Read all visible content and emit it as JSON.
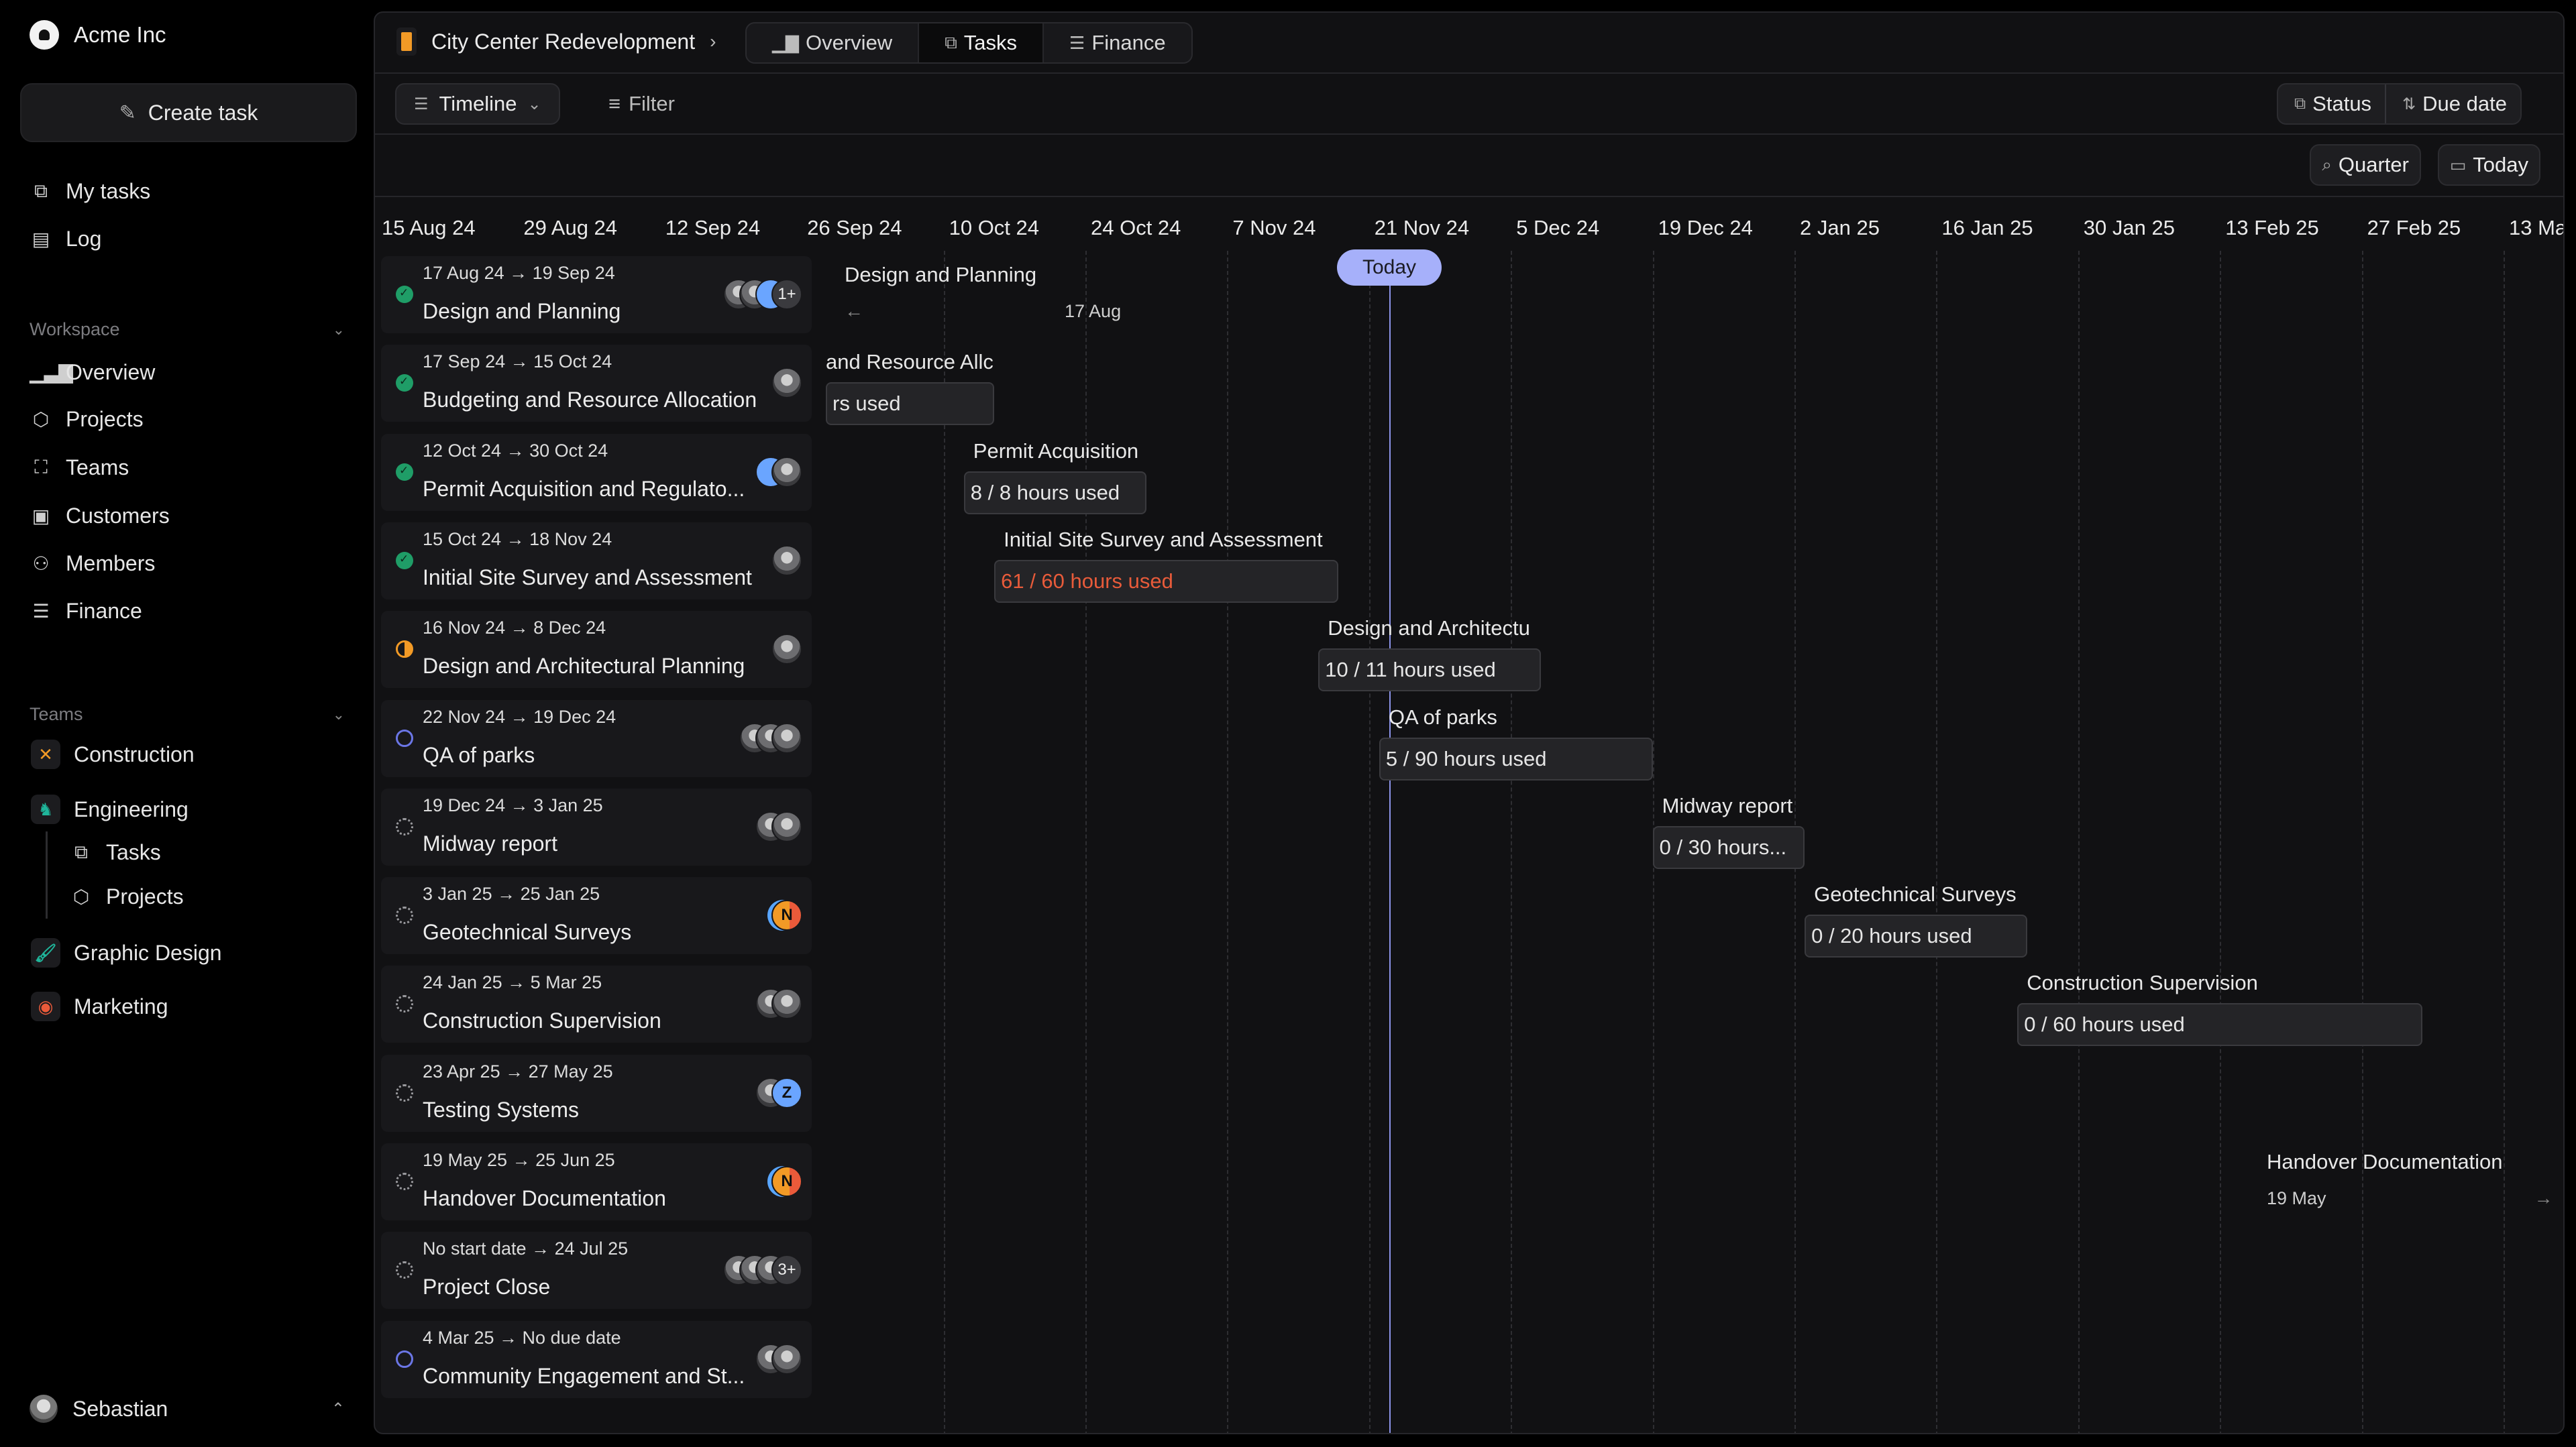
{
  "brand": {
    "name": "Acme Inc"
  },
  "sidebar": {
    "create_task": "Create task",
    "top_items": [
      {
        "label": "My tasks",
        "icon": "layers-icon"
      },
      {
        "label": "Log",
        "icon": "document-icon"
      }
    ],
    "workspace": {
      "heading": "Workspace",
      "items": [
        {
          "label": "Overview",
          "icon": "bar-chart-icon"
        },
        {
          "label": "Projects",
          "icon": "cube-icon"
        },
        {
          "label": "Teams",
          "icon": "scan-icon"
        },
        {
          "label": "Customers",
          "icon": "contact-icon"
        },
        {
          "label": "Members",
          "icon": "users-icon"
        },
        {
          "label": "Finance",
          "icon": "database-icon"
        }
      ]
    },
    "teams": {
      "heading": "Teams",
      "items": [
        {
          "label": "Construction",
          "icon": "tools-icon",
          "color": "#f29a26"
        },
        {
          "label": "Engineering",
          "icon": "elephant-icon",
          "color": "#1fb59a",
          "children": [
            {
              "label": "Tasks",
              "icon": "layers-icon"
            },
            {
              "label": "Projects",
              "icon": "cube-icon"
            }
          ]
        },
        {
          "label": "Graphic Design",
          "icon": "brush-icon",
          "color": "#1fb59a"
        },
        {
          "label": "Marketing",
          "icon": "camera-icon",
          "color": "#ea5a3a"
        }
      ]
    },
    "user": {
      "name": "Sebastian"
    }
  },
  "header": {
    "project": "City Center Redevelopment",
    "tabs": [
      {
        "label": "Overview",
        "icon": "bar-chart-icon",
        "active": false
      },
      {
        "label": "Tasks",
        "icon": "layers-icon",
        "active": true
      },
      {
        "label": "Finance",
        "icon": "database-icon",
        "active": false
      }
    ]
  },
  "toolbar": {
    "view": "Timeline",
    "filter": "Filter",
    "group": "Status",
    "sort": "Due date",
    "zoom": "Quarter",
    "today": "Today"
  },
  "timeline": {
    "origin": "2024-08-15",
    "today": "2024-11-23",
    "today_label": "Today",
    "date_labels": [
      "15 Aug 24",
      "29 Aug 24",
      "12 Sep 24",
      "26 Sep 24",
      "10 Oct 24",
      "24 Oct 24",
      "7 Nov 24",
      "21 Nov 24",
      "5 Dec 24",
      "19 Dec 24",
      "2 Jan 25",
      "16 Jan 25",
      "30 Jan 25",
      "13 Feb 25",
      "27 Feb 25",
      "13 Mar 25"
    ],
    "bars": [
      {
        "label": "Design and Planning",
        "start": "2024-08-17",
        "end": "2024-09-19",
        "offscreen": "left",
        "offscreen_date": "17 Aug"
      },
      {
        "label": "Budgeting and Resource Allocation",
        "start": "2024-09-17",
        "end": "2024-10-15",
        "hours": "hours used",
        "visible_label": "and Resource Allc",
        "visible_hours": "rs used"
      },
      {
        "label": "Permit Acquisition",
        "start": "2024-10-12",
        "end": "2024-10-30",
        "hours": "8 / 8 hours used"
      },
      {
        "label": "Initial Site Survey and Assessment",
        "start": "2024-10-15",
        "end": "2024-11-18",
        "hours": "61 / 60 hours used",
        "over_budget": true
      },
      {
        "label": "Design and Architectu",
        "start": "2024-11-16",
        "end": "2024-12-08",
        "hours": "10 / 11 hours used"
      },
      {
        "label": "QA of parks",
        "start": "2024-11-22",
        "end": "2024-12-19",
        "hours": "5 / 90 hours used"
      },
      {
        "label": "Midway report",
        "start": "2024-12-19",
        "end": "2025-01-03",
        "hours": "0 / 30 hours..."
      },
      {
        "label": "Geotechnical Surveys",
        "start": "2025-01-03",
        "end": "2025-01-25",
        "hours": "0 / 20 hours used"
      },
      {
        "label": "Construction Supervision",
        "start": "2025-01-24",
        "end": "2025-03-05",
        "hours": "0 / 60 hours used"
      },
      null,
      {
        "label": "Handover Documentation",
        "start": "2025-05-19",
        "end": "2025-06-25",
        "offscreen": "right",
        "offscreen_date": "19 May"
      },
      null,
      null
    ]
  },
  "tasks": [
    {
      "dates": "17 Aug 24 → 19 Sep 24",
      "title": "Design and Planning",
      "status": "done",
      "avatars": [
        "photo",
        "photo",
        "blue"
      ],
      "more": "1+"
    },
    {
      "dates": "17 Sep 24 → 15 Oct 24",
      "title": "Budgeting and Resource Allocation",
      "status": "done",
      "avatars": [
        "photo"
      ]
    },
    {
      "dates": "12 Oct 24 → 30 Oct 24",
      "title": "Permit Acquisition and Regulato...",
      "status": "done",
      "avatars": [
        "blue",
        "photo"
      ]
    },
    {
      "dates": "15 Oct 24 → 18 Nov 24",
      "title": "Initial Site Survey and Assessment",
      "status": "done",
      "avatars": [
        "photo"
      ]
    },
    {
      "dates": "16 Nov 24 → 8 Dec 24",
      "title": "Design and Architectural Planning",
      "status": "progress",
      "avatars": [
        "photo"
      ]
    },
    {
      "dates": "22 Nov 24 → 19 Dec 24",
      "title": "QA of parks",
      "status": "todo",
      "avatars": [
        "photo",
        "photo",
        "photo"
      ]
    },
    {
      "dates": "19 Dec 24 → 3 Jan 25",
      "title": "Midway report",
      "status": "backlog",
      "avatars": [
        "photo",
        "photo"
      ]
    },
    {
      "dates": "3 Jan 25 → 25 Jan 25",
      "title": "Geotechnical Surveys",
      "status": "backlog",
      "avatars": [
        "N"
      ]
    },
    {
      "dates": "24 Jan 25 → 5 Mar 25",
      "title": "Construction Supervision",
      "status": "backlog",
      "avatars": [
        "photo",
        "photo"
      ]
    },
    {
      "dates": "23 Apr 25 → 27 May 25",
      "title": "Testing Systems",
      "status": "backlog",
      "avatars": [
        "photo",
        "Z"
      ]
    },
    {
      "dates": "19 May 25 → 25 Jun 25",
      "title": "Handover Documentation",
      "status": "backlog",
      "avatars": [
        "N"
      ]
    },
    {
      "dates": "No start date → 24 Jul 25",
      "title": "Project Close",
      "status": "backlog",
      "avatars": [
        "photo",
        "photo",
        "photo"
      ],
      "more": "3+"
    },
    {
      "dates": "4 Mar 25 → No due date",
      "title": "Community Engagement and St...",
      "status": "todo",
      "avatars": [
        "photo",
        "photo"
      ]
    }
  ],
  "colors": {
    "accent": "#a6b0fa",
    "done": "#1f9d67",
    "progress": "#f29a26",
    "todo": "#6b76e6",
    "over_budget": "#e85b3a"
  }
}
